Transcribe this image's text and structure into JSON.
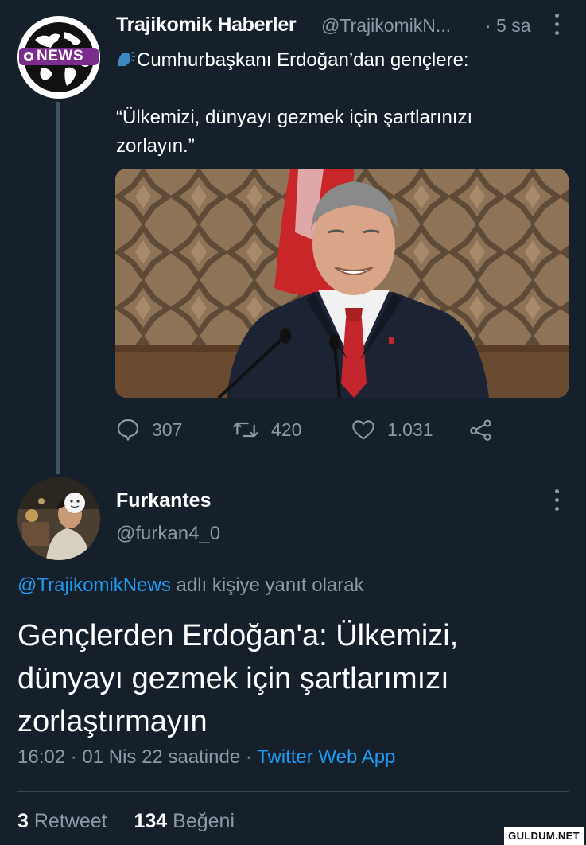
{
  "tweet": {
    "author_name": "Trajikomik Haberler",
    "author_handle": "@TrajikomikN...",
    "time": "· 5 sa",
    "avatar_badge": "NEWS",
    "text_line1": "Cumhurbaşkanı Erdoğan’dan gençlere:",
    "text_line2": "“Ülkemizi, dünyayı gezmek için şartlarınızı",
    "text_line3": "zorlayın.”",
    "speaking_icon": "speaking-head-icon",
    "replies": "307",
    "retweets": "420",
    "likes": "1.031"
  },
  "reply": {
    "author_name": "Furkantes",
    "author_handle": "@furkan4_0",
    "replying_mention": "@TrajikomikNews",
    "replying_suffix": "adlı kişiye yanıt olarak",
    "text_line1": "Gençlerden Erdoğan'a: Ülkemizi,",
    "text_line2": "dünyayı gezmek için şartlarımızı",
    "text_line3": "zorlaştırmayın",
    "timestamp": "16:02 · 01 Nis 22 saatinde ·",
    "source": "Twitter Web App",
    "retweet_count": "3",
    "retweet_label": "Retweet",
    "like_count": "134",
    "like_label": "Beğeni"
  },
  "watermark": "GULDUM.NET",
  "colors": {
    "background": "#15202b",
    "muted": "#8b98a5",
    "link": "#1d9bf0",
    "thread_line": "#3d5466"
  }
}
